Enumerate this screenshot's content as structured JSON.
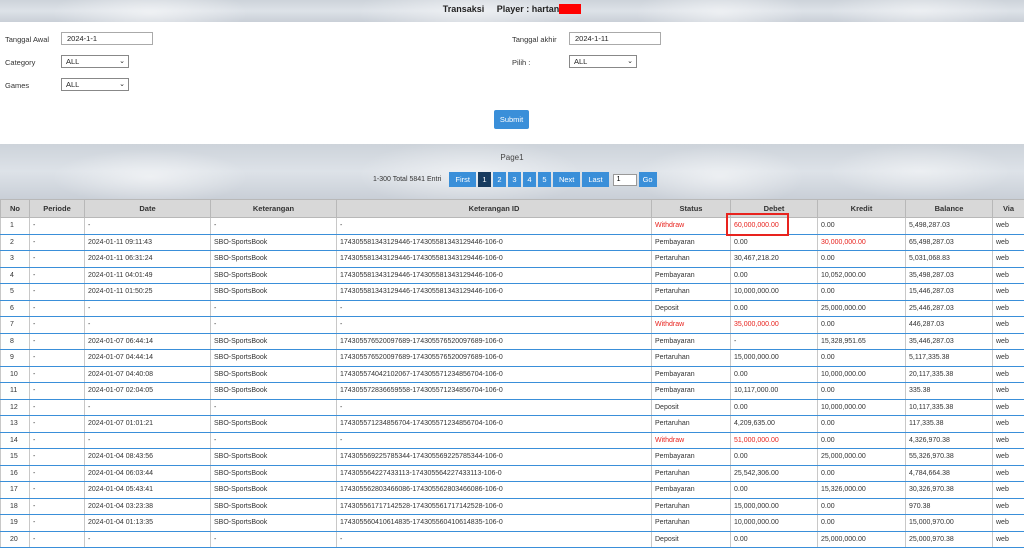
{
  "header": {
    "title_prefix": "Transaksi",
    "player_label": "Player : hartan"
  },
  "filters": {
    "tanggal_awal_label": "Tanggal Awal",
    "tanggal_awal_value": "2024-1-1",
    "tanggal_akhir_label": "Tanggal akhir",
    "tanggal_akhir_value": "2024-1-11",
    "category_label": "Category",
    "category_value": "ALL",
    "pilih_label": "Pilih :",
    "pilih_value": "ALL",
    "games_label": "Games",
    "games_value": "ALL",
    "submit_label": "Submit"
  },
  "pagination": {
    "page_label": "Page1",
    "info": "1-300 Total 5841 Entri",
    "first": "First",
    "pages": [
      "1",
      "2",
      "3",
      "4",
      "5"
    ],
    "active_page": "1",
    "next": "Next",
    "last": "Last",
    "goto_value": "1",
    "go": "Go"
  },
  "table": {
    "headers": [
      "No",
      "Periode",
      "Date",
      "Keterangan",
      "Keterangan ID",
      "Status",
      "Debet",
      "Kredit",
      "Balance",
      "Via"
    ],
    "rows": [
      {
        "no": "1",
        "periode": "-",
        "date": "-",
        "ket": "-",
        "ket_id": "-",
        "status": "Withdraw",
        "debet": "60,000,000.00",
        "kredit": "0.00",
        "balance": "5,498,287.03",
        "via": "web"
      },
      {
        "no": "2",
        "periode": "-",
        "date": "2024-01-11 09:11:43",
        "ket": "SBO-SportsBook",
        "ket_id": "174305581343129446-174305581343129446-106-0",
        "status": "Pembayaran",
        "debet": "0.00",
        "kredit": "30,000,000.00",
        "balance": "65,498,287.03",
        "via": "web"
      },
      {
        "no": "3",
        "periode": "-",
        "date": "2024-01-11 06:31:24",
        "ket": "SBO-SportsBook",
        "ket_id": "174305581343129446-174305581343129446-106-0",
        "status": "Pertaruhan",
        "debet": "30,467,218.20",
        "kredit": "0.00",
        "balance": "5,031,068.83",
        "via": "web"
      },
      {
        "no": "4",
        "periode": "-",
        "date": "2024-01-11 04:01:49",
        "ket": "SBO-SportsBook",
        "ket_id": "174305581343129446-174305581343129446-106-0",
        "status": "Pembayaran",
        "debet": "0.00",
        "kredit": "10,052,000.00",
        "balance": "35,498,287.03",
        "via": "web"
      },
      {
        "no": "5",
        "periode": "-",
        "date": "2024-01-11 01:50:25",
        "ket": "SBO-SportsBook",
        "ket_id": "174305581343129446-174305581343129446-106-0",
        "status": "Pertaruhan",
        "debet": "10,000,000.00",
        "kredit": "0.00",
        "balance": "15,446,287.03",
        "via": "web"
      },
      {
        "no": "6",
        "periode": "-",
        "date": "-",
        "ket": "-",
        "ket_id": "-",
        "status": "Deposit",
        "debet": "0.00",
        "kredit": "25,000,000.00",
        "balance": "25,446,287.03",
        "via": "web"
      },
      {
        "no": "7",
        "periode": "-",
        "date": "-",
        "ket": "-",
        "ket_id": "-",
        "status": "Withdraw",
        "debet": "35,000,000.00",
        "kredit": "0.00",
        "balance": "446,287.03",
        "via": "web"
      },
      {
        "no": "8",
        "periode": "-",
        "date": "2024-01-07 06:44:14",
        "ket": "SBO-SportsBook",
        "ket_id": "174305576520097689-174305576520097689-106-0",
        "status": "Pembayaran",
        "debet": "-",
        "kredit": "15,328,951.65",
        "balance": "35,446,287.03",
        "via": "web"
      },
      {
        "no": "9",
        "periode": "-",
        "date": "2024-01-07 04:44:14",
        "ket": "SBO-SportsBook",
        "ket_id": "174305576520097689-174305576520097689-106-0",
        "status": "Pertaruhan",
        "debet": "15,000,000.00",
        "kredit": "0.00",
        "balance": "5,117,335.38",
        "via": "web"
      },
      {
        "no": "10",
        "periode": "-",
        "date": "2024-01-07 04:40:08",
        "ket": "SBO-SportsBook",
        "ket_id": "174305574042102067-174305571234856704-106-0",
        "status": "Pembayaran",
        "debet": "0.00",
        "kredit": "10,000,000.00",
        "balance": "20,117,335.38",
        "via": "web"
      },
      {
        "no": "11",
        "periode": "-",
        "date": "2024-01-07 02:04:05",
        "ket": "SBO-SportsBook",
        "ket_id": "174305572836659558-174305571234856704-106-0",
        "status": "Pembayaran",
        "debet": "10,117,000.00",
        "kredit": "0.00",
        "balance": "335.38",
        "via": "web"
      },
      {
        "no": "12",
        "periode": "-",
        "date": "-",
        "ket": "-",
        "ket_id": "-",
        "status": "Deposit",
        "debet": "0.00",
        "kredit": "10,000,000.00",
        "balance": "10,117,335.38",
        "via": "web"
      },
      {
        "no": "13",
        "periode": "-",
        "date": "2024-01-07 01:01:21",
        "ket": "SBO-SportsBook",
        "ket_id": "174305571234856704-174305571234856704-106-0",
        "status": "Pertaruhan",
        "debet": "4,209,635.00",
        "kredit": "0.00",
        "balance": "117,335.38",
        "via": "web"
      },
      {
        "no": "14",
        "periode": "-",
        "date": "-",
        "ket": "-",
        "ket_id": "-",
        "status": "Withdraw",
        "debet": "51,000,000.00",
        "kredit": "0.00",
        "balance": "4,326,970.38",
        "via": "web"
      },
      {
        "no": "15",
        "periode": "-",
        "date": "2024-01-04 08:43:56",
        "ket": "SBO-SportsBook",
        "ket_id": "174305569225785344-174305569225785344-106-0",
        "status": "Pembayaran",
        "debet": "0.00",
        "kredit": "25,000,000.00",
        "balance": "55,326,970.38",
        "via": "web"
      },
      {
        "no": "16",
        "periode": "-",
        "date": "2024-01-04 06:03:44",
        "ket": "SBO-SportsBook",
        "ket_id": "174305564227433113-174305564227433113-106-0",
        "status": "Pertaruhan",
        "debet": "25,542,306.00",
        "kredit": "0.00",
        "balance": "4,784,664.38",
        "via": "web"
      },
      {
        "no": "17",
        "periode": "-",
        "date": "2024-01-04 05:43:41",
        "ket": "SBO-SportsBook",
        "ket_id": "174305562803466086-174305562803466086-106-0",
        "status": "Pembayaran",
        "debet": "0.00",
        "kredit": "15,326,000.00",
        "balance": "30,326,970.38",
        "via": "web"
      },
      {
        "no": "18",
        "periode": "-",
        "date": "2024-01-04 03:23:38",
        "ket": "SBO-SportsBook",
        "ket_id": "174305561717142528-174305561717142528-106-0",
        "status": "Pertaruhan",
        "debet": "15,000,000.00",
        "kredit": "0.00",
        "balance": "970.38",
        "via": "web"
      },
      {
        "no": "19",
        "periode": "-",
        "date": "2024-01-04 01:13:35",
        "ket": "SBO-SportsBook",
        "ket_id": "174305560410614835-174305560410614835-106-0",
        "status": "Pertaruhan",
        "debet": "10,000,000.00",
        "kredit": "0.00",
        "balance": "15,000,970.00",
        "via": "web"
      },
      {
        "no": "20",
        "periode": "-",
        "date": "-",
        "ket": "-",
        "ket_id": "-",
        "status": "Deposit",
        "debet": "0.00",
        "kredit": "25,000,000.00",
        "balance": "25,000,970.38",
        "via": "web"
      }
    ]
  },
  "colors": {
    "accent": "#3a8fd9",
    "active_page": "#173a5e",
    "withdraw_red": "#e8231e",
    "redaction": "#ff0000"
  }
}
